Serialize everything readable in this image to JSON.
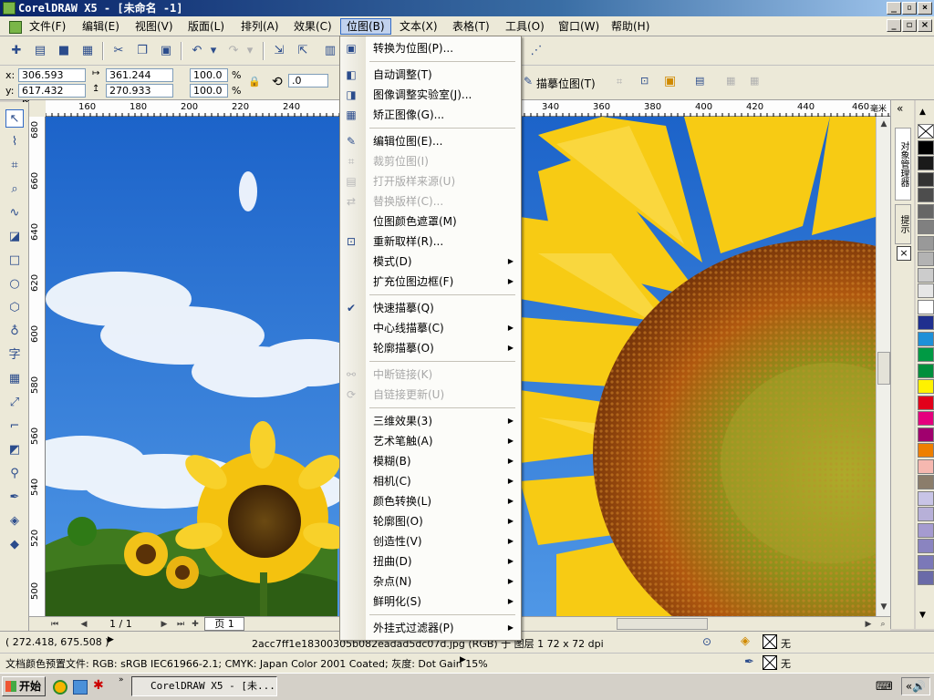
{
  "window": {
    "title": "CorelDRAW X5 - [未命名 -1]"
  },
  "menubar": {
    "items": [
      "文件(F)",
      "编辑(E)",
      "视图(V)",
      "版面(L)",
      "排列(A)",
      "效果(C)",
      "位图(B)",
      "文本(X)",
      "表格(T)",
      "工具(O)",
      "窗口(W)",
      "帮助(H)"
    ],
    "active": "位图(B)"
  },
  "propbar": {
    "x_label": "x:",
    "y_label": "y:",
    "x_value": "306.593 mm",
    "y_value": "617.432 mm",
    "w_value": "361.244 mm",
    "h_value": "270.933 mm",
    "scale_x": "100.0",
    "scale_y": "100.0",
    "percent": "%",
    "rotate": ".0",
    "trace_label": "描摹位图(T)"
  },
  "ruler": {
    "h_labels": [
      "160",
      "180",
      "200",
      "220",
      "240",
      "340",
      "360",
      "380",
      "400",
      "420",
      "440",
      "460"
    ],
    "h_unit": "毫米",
    "v_labels": [
      "680",
      "660",
      "640",
      "620",
      "600",
      "580",
      "560",
      "540",
      "520",
      "500"
    ]
  },
  "bitmap_menu": {
    "items": [
      {
        "label": "转换为位图(P)...",
        "icon": "convert-bitmap-icon",
        "disabled": false,
        "submenu": false
      },
      {
        "sep": true
      },
      {
        "label": "自动调整(T)",
        "icon": "auto-adjust-icon",
        "disabled": false,
        "submenu": false
      },
      {
        "label": "图像调整实验室(J)...",
        "icon": "image-lab-icon",
        "disabled": false,
        "submenu": false
      },
      {
        "label": "矫正图像(G)...",
        "icon": "straighten-icon",
        "disabled": false,
        "submenu": false
      },
      {
        "sep": true
      },
      {
        "label": "编辑位图(E)...",
        "icon": "edit-bitmap-icon",
        "disabled": false,
        "submenu": false
      },
      {
        "label": "裁剪位图(I)",
        "icon": "crop-bitmap-icon",
        "disabled": true,
        "submenu": false
      },
      {
        "label": "打开版样来源(U)",
        "icon": "open-source-icon",
        "disabled": true,
        "submenu": false
      },
      {
        "label": "替换版样(C)...",
        "icon": "replace-icon",
        "disabled": true,
        "submenu": false
      },
      {
        "label": "位图颜色遮罩(M)",
        "icon": "",
        "disabled": false,
        "submenu": false
      },
      {
        "label": "重新取样(R)...",
        "icon": "resample-icon",
        "disabled": false,
        "submenu": false
      },
      {
        "label": "模式(D)",
        "icon": "",
        "disabled": false,
        "submenu": true
      },
      {
        "label": "扩充位图边框(F)",
        "icon": "",
        "disabled": false,
        "submenu": true
      },
      {
        "sep": true
      },
      {
        "label": "快速描摹(Q)",
        "icon": "quick-trace-icon",
        "disabled": false,
        "submenu": false
      },
      {
        "label": "中心线描摹(C)",
        "icon": "",
        "disabled": false,
        "submenu": true
      },
      {
        "label": "轮廓描摹(O)",
        "icon": "",
        "disabled": false,
        "submenu": true
      },
      {
        "sep": true
      },
      {
        "label": "中断链接(K)",
        "icon": "break-link-icon",
        "disabled": true,
        "submenu": false
      },
      {
        "label": "自链接更新(U)",
        "icon": "update-link-icon",
        "disabled": true,
        "submenu": false
      },
      {
        "sep": true
      },
      {
        "label": "三维效果(3)",
        "icon": "",
        "disabled": false,
        "submenu": true
      },
      {
        "label": "艺术笔触(A)",
        "icon": "",
        "disabled": false,
        "submenu": true
      },
      {
        "label": "模糊(B)",
        "icon": "",
        "disabled": false,
        "submenu": true
      },
      {
        "label": "相机(C)",
        "icon": "",
        "disabled": false,
        "submenu": true
      },
      {
        "label": "颜色转换(L)",
        "icon": "",
        "disabled": false,
        "submenu": true
      },
      {
        "label": "轮廓图(O)",
        "icon": "",
        "disabled": false,
        "submenu": true
      },
      {
        "label": "创造性(V)",
        "icon": "",
        "disabled": false,
        "submenu": true
      },
      {
        "label": "扭曲(D)",
        "icon": "",
        "disabled": false,
        "submenu": true
      },
      {
        "label": "杂点(N)",
        "icon": "",
        "disabled": false,
        "submenu": true
      },
      {
        "label": "鲜明化(S)",
        "icon": "",
        "disabled": false,
        "submenu": true
      },
      {
        "sep": true
      },
      {
        "label": "外挂式过滤器(P)",
        "icon": "",
        "disabled": false,
        "submenu": true
      }
    ]
  },
  "pagenav": {
    "page_count": "1 / 1",
    "page_tab": "页 1"
  },
  "docker": {
    "tab1": "对象管理器",
    "tab2": "提示"
  },
  "palette": {
    "colors": [
      "#ffffff",
      "#000000",
      "#1a1a1a",
      "#333333",
      "#4d4d4d",
      "#666666",
      "#808080",
      "#999999",
      "#b3b3b3",
      "#cccccc",
      "#e6e6e6",
      "#ffffff",
      "#1f2f8f",
      "#1e90d8",
      "#009a44",
      "#008f3c",
      "#fff200",
      "#e2001a",
      "#e5007e",
      "#a0006e",
      "#ee7f00",
      "#f6b8b0",
      "#8b7d6b",
      "#c8c4e6",
      "#b7b0d8",
      "#a59bd0",
      "#8a84c0",
      "#7b78b8",
      "#6a6aa8"
    ]
  },
  "status": {
    "coords": "( 272.418, 675.508 )",
    "file_info": "2acc7ff1e18300305b082eadad5dc07d.jpg (RGB) 于 图层 1 72 x 72 dpi",
    "fill_none": "无",
    "outline_none": "无",
    "color_profile": "文档颜色预置文件: RGB: sRGB IEC61966-2.1; CMYK: Japan Color 2001 Coated; 灰度: Dot Gain 15%"
  },
  "taskbar": {
    "start": "开始",
    "app": "CorelDRAW X5 - [未..."
  }
}
